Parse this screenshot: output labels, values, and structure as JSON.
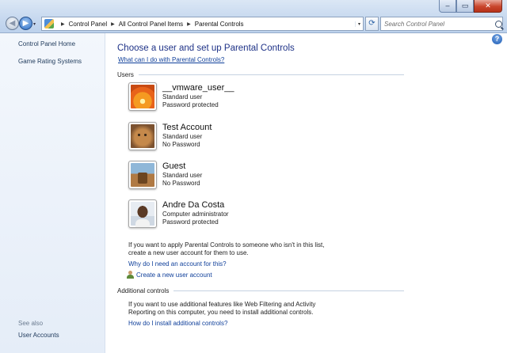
{
  "window": {
    "controls": {
      "minimize": "–",
      "maximize": "▭",
      "close": "✕"
    }
  },
  "nav": {
    "back_glyph": "◀",
    "forward_glyph": "▶",
    "recent_glyph": "▾",
    "breadcrumbs": [
      "Control Panel",
      "All Control Panel Items",
      "Parental Controls"
    ],
    "breadcrumb_separator": "▶",
    "address_dropdown_glyph": "▾",
    "refresh_glyph": "⟳",
    "search_placeholder": "Search Control Panel",
    "help_glyph": "?"
  },
  "sidebar": {
    "items": [
      {
        "label": "Control Panel Home"
      },
      {
        "label": "Game Rating Systems"
      }
    ],
    "see_also_label": "See also",
    "see_also_items": [
      {
        "label": "User Accounts"
      }
    ]
  },
  "main": {
    "title": "Choose a user and set up Parental Controls",
    "what_can_link": "What can I do with Parental Controls?",
    "users_section_label": "Users",
    "users": [
      {
        "name": "__vmware_user__",
        "role": "Standard user",
        "password": "Password protected",
        "picture": "flower"
      },
      {
        "name": "Test Account",
        "role": "Standard user",
        "password": "No Password",
        "picture": "cat"
      },
      {
        "name": "Guest",
        "role": "Standard user",
        "password": "No Password",
        "picture": "briefcase"
      },
      {
        "name": "Andre Da Costa",
        "role": "Computer administrator",
        "password": "Password protected",
        "picture": "person-photo"
      }
    ],
    "not_in_list_text_line1": "If you want to apply Parental Controls to someone who isn't in this list,",
    "not_in_list_text_line2": "create a new user account for them to use.",
    "why_account_link": "Why do I need an account for this?",
    "create_account_link": "Create a new user account",
    "additional_section_label": "Additional controls",
    "additional_text_line1": "If you want to use additional features like Web Filtering and Activity",
    "additional_text_line2": "Reporting on this computer, you need to install additional controls.",
    "install_link": "How do I install additional controls?"
  }
}
